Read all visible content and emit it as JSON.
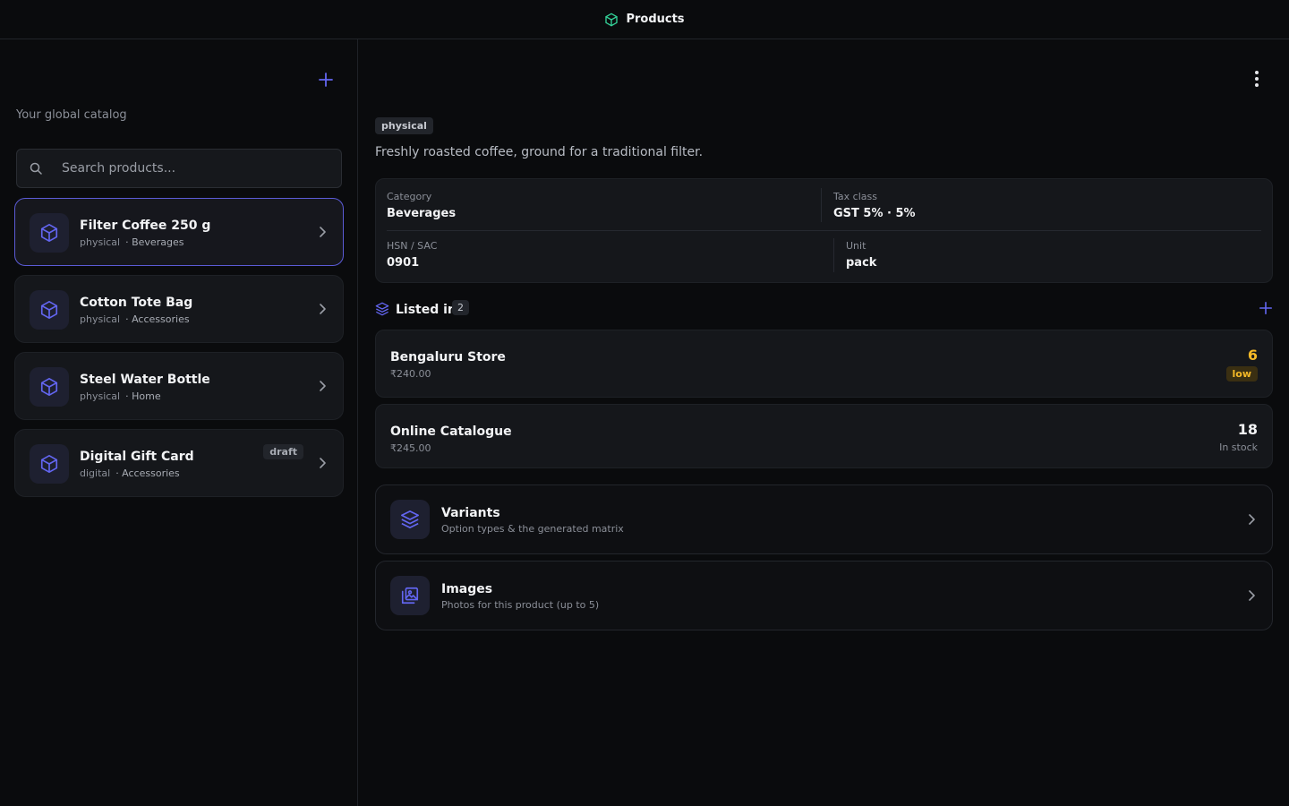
{
  "header": {
    "title": "Products"
  },
  "sidebar": {
    "subtitle": "Your global catalog",
    "search": {
      "placeholder": "Search products..."
    },
    "products": [
      {
        "name": "Filter Coffee 250 g",
        "type": "physical",
        "category": "· Beverages",
        "draft": ""
      },
      {
        "name": "Cotton Tote Bag",
        "type": "physical",
        "category": "· Accessories",
        "draft": ""
      },
      {
        "name": "Steel Water Bottle",
        "type": "physical",
        "category": "· Home",
        "draft": ""
      },
      {
        "name": "Digital Gift Card",
        "type": "digital",
        "category": "· Accessories",
        "draft": "draft"
      }
    ]
  },
  "detail": {
    "type_badge": "physical",
    "description": "Freshly roasted coffee, ground for a traditional filter.",
    "info": {
      "category_label": "Category",
      "category": "Beverages",
      "tax_label": "Tax class",
      "tax": "GST 5% · 5%",
      "hsn_label": "HSN / SAC",
      "hsn": "0901",
      "unit_label": "Unit",
      "unit": "pack"
    },
    "listed": {
      "title": "Listed in",
      "count": "2",
      "items": [
        {
          "name": "Bengaluru Store",
          "price": "₹240.00",
          "qty": "6",
          "status": "low"
        },
        {
          "name": "Online Catalogue",
          "price": "₹245.00",
          "qty": "18",
          "status": "In stock"
        }
      ]
    },
    "sections": [
      {
        "title": "Variants",
        "subtitle": "Option types & the generated matrix"
      },
      {
        "title": "Images",
        "subtitle": "Photos for this product (up to 5)"
      }
    ]
  },
  "colors": {
    "accent": "#6366f1",
    "brand_green": "#34d399",
    "warning": "#f5b927"
  }
}
